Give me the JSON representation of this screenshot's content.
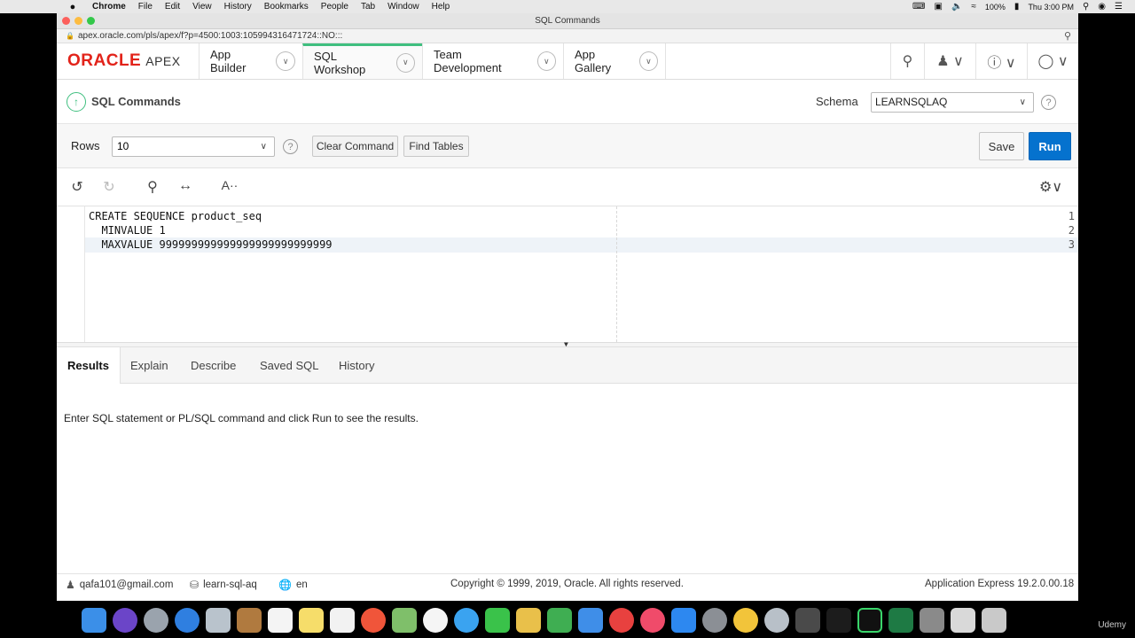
{
  "os_menu": {
    "apple": "",
    "app": "Chrome",
    "items": [
      "File",
      "Edit",
      "View",
      "History",
      "Bookmarks",
      "People",
      "Tab",
      "Window",
      "Help"
    ],
    "battery": "100%",
    "clock": "Thu 3:00 PM"
  },
  "window": {
    "title": "SQL Commands",
    "url": "apex.oracle.com/pls/apex/f?p=4500:1003:105994316471724::NO:::"
  },
  "apex_nav": {
    "logo_brand": "ORACLE",
    "logo_product": "APEX",
    "tabs": [
      {
        "label": "App Builder"
      },
      {
        "label": "SQL Workshop"
      },
      {
        "label": "Team Development"
      },
      {
        "label": "App Gallery"
      }
    ]
  },
  "page": {
    "title": "SQL Commands",
    "schema_label": "Schema",
    "schema_value": "LEARNSQLAQ"
  },
  "toolbar": {
    "rows_label": "Rows",
    "rows_value": "10",
    "clear_label": "Clear Command",
    "find_tables_label": "Find Tables",
    "save_label": "Save",
    "run_label": "Run"
  },
  "editor": {
    "lines": [
      {
        "no": "1",
        "code": "CREATE SEQUENCE product_seq"
      },
      {
        "no": "2",
        "code": "  MINVALUE 1"
      },
      {
        "no": "3",
        "code": "  MAXVALUE 999999999999999999999999999"
      }
    ]
  },
  "results": {
    "tabs": [
      "Results",
      "Explain",
      "Describe",
      "Saved SQL",
      "History"
    ],
    "message": "Enter SQL statement or PL/SQL command and click Run to see the results."
  },
  "footer": {
    "user": "qafa101@gmail.com",
    "workspace": "learn-sql-aq",
    "language": "en",
    "copyright": "Copyright © 1999, 2019, Oracle. All rights reserved.",
    "version": "Application Express 19.2.0.00.18"
  },
  "watermark": "Udemy",
  "colors": {
    "accent_green": "#3fbf7f",
    "run_blue": "#0572ce",
    "oracle_red": "#e2231a"
  }
}
